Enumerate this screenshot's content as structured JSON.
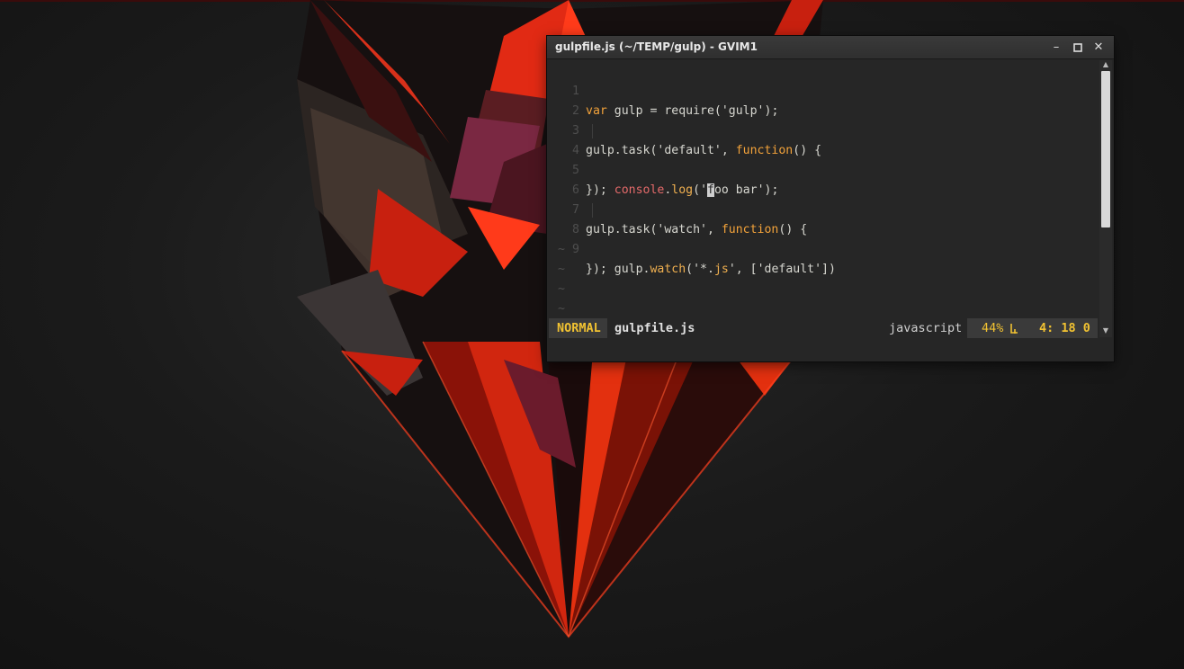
{
  "window": {
    "title": "gulpfile.js (~/TEMP/gulp) - GVIM1",
    "minimize_icon": "minimize-icon",
    "maximize_icon": "maximize-icon",
    "close_icon": "close-icon"
  },
  "editor": {
    "line_numbers": [
      "1",
      "2",
      "3",
      "4",
      "5",
      "6",
      "7",
      "8",
      "9"
    ],
    "lines": [
      "var gulp = require('gulp');",
      "",
      "gulp.task('default', function() {",
      "    console.log('foo bar');",
      "});",
      "",
      "gulp.task('watch', function() {",
      "    gulp.watch('*.js', ['default'])",
      "});"
    ],
    "empty_line_marker": "~"
  },
  "status_line": {
    "mode": "NORMAL",
    "file_name": "gulpfile.js",
    "file_type": "javascript",
    "percent": "44%",
    "line_icon": "ln-icon",
    "cursor_position": "4: 18 0"
  },
  "colors": {
    "mode_text": "#f1c232",
    "keyword": "#f2a23a",
    "object": "#e46a6a",
    "background": "#262626"
  }
}
